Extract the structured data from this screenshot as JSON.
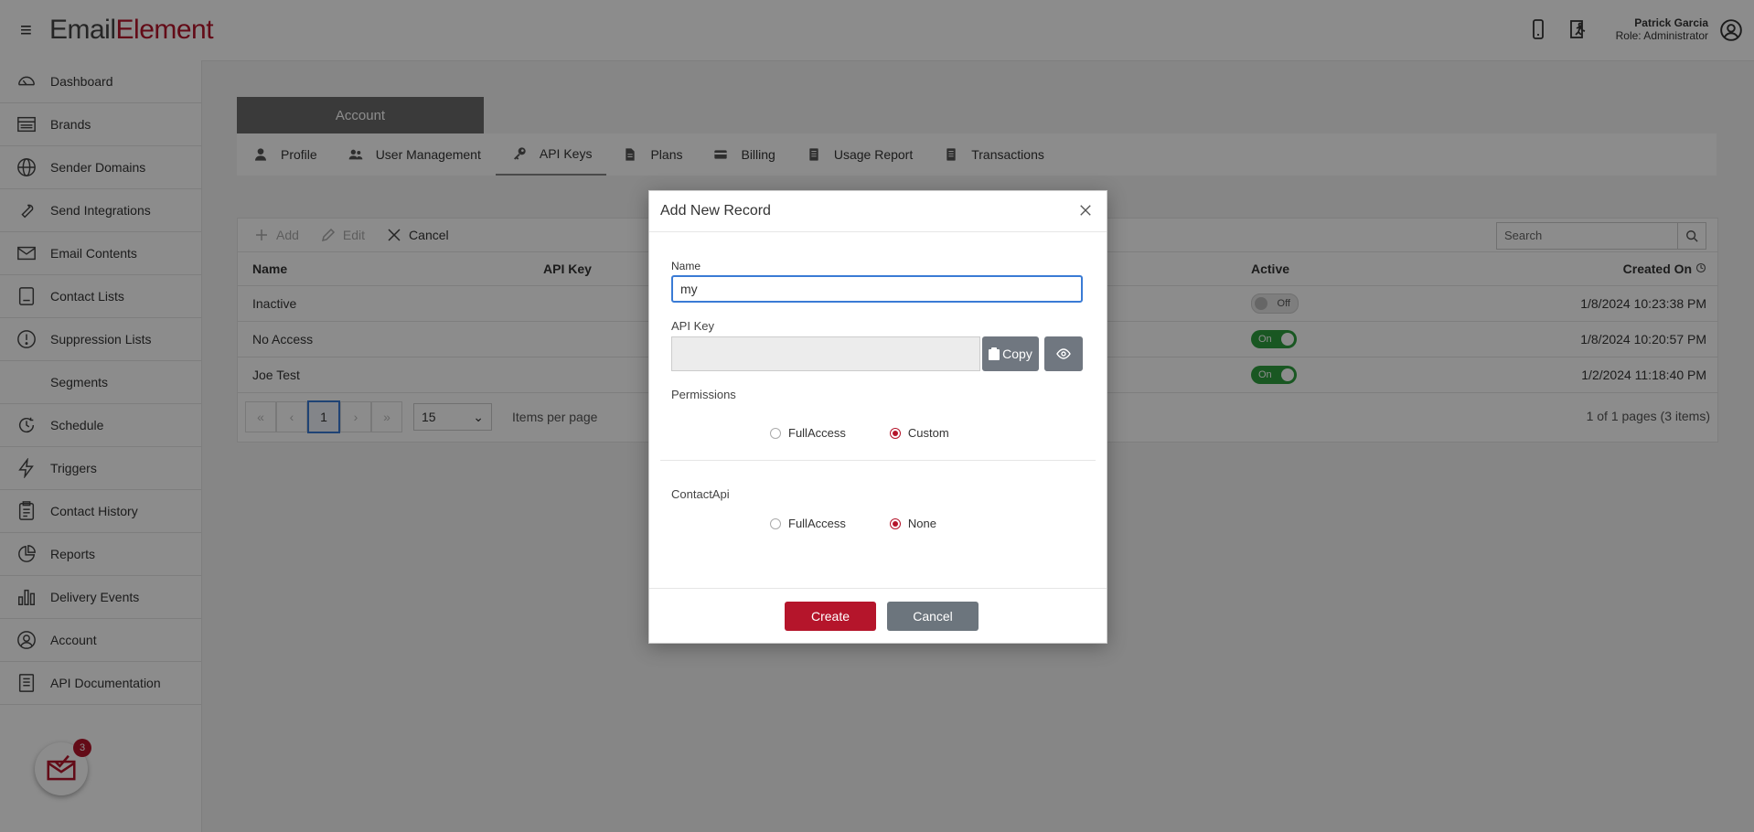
{
  "app": {
    "logo_part1": "Em",
    "logo_part2": "ail",
    "logo_part3": "Element",
    "user_name": "Patrick Garcia",
    "user_role": "Role: Administrator"
  },
  "sidebar": {
    "items": [
      {
        "label": "Dashboard",
        "icon": "gauge-icon"
      },
      {
        "label": "Brands",
        "icon": "brands-icon"
      },
      {
        "label": "Sender Domains",
        "icon": "globe-icon"
      },
      {
        "label": "Send Integrations",
        "icon": "wrench-icon"
      },
      {
        "label": "Email Contents",
        "icon": "envelope-icon"
      },
      {
        "label": "Contact Lists",
        "icon": "list-icon"
      },
      {
        "label": "Suppression Lists",
        "icon": "alert-icon"
      },
      {
        "label": "Segments",
        "icon": ""
      },
      {
        "label": "Schedule",
        "icon": "clock-icon"
      },
      {
        "label": "Triggers",
        "icon": "bolt-icon"
      },
      {
        "label": "Contact History",
        "icon": "clipboard-icon"
      },
      {
        "label": "Reports",
        "icon": "pie-icon"
      },
      {
        "label": "Delivery Events",
        "icon": "bar-chart-icon"
      },
      {
        "label": "Account",
        "icon": "user-circle-icon"
      },
      {
        "label": "API Documentation",
        "icon": "doc-icon"
      }
    ],
    "notification_count": "3"
  },
  "account": {
    "tab_label": "Account",
    "subtabs": [
      "Profile",
      "User Management",
      "API Keys",
      "Plans",
      "Billing",
      "Usage Report",
      "Transactions"
    ]
  },
  "grid": {
    "toolbar": {
      "add": "Add",
      "edit": "Edit",
      "cancel": "Cancel"
    },
    "search_placeholder": "Search",
    "columns": {
      "name": "Name",
      "api_key": "API Key",
      "active": "Active",
      "created_on": "Created On"
    },
    "rows": [
      {
        "name": "Inactive",
        "active": "Off",
        "created": "1/8/2024 10:23:38 PM"
      },
      {
        "name": "No Access",
        "active": "On",
        "created": "1/8/2024 10:20:57 PM"
      },
      {
        "name": "Joe Test",
        "active": "On",
        "created": "1/2/2024 11:18:40 PM"
      }
    ],
    "pager": {
      "current": "1",
      "page_size": "15",
      "items_per_page": "Items per page",
      "info": "1 of 1 pages (3 items)"
    }
  },
  "dialog": {
    "title": "Add New Record",
    "name_label": "Name",
    "name_value": "my",
    "api_key_label": "API Key",
    "copy_label": "Copy",
    "permissions_label": "Permissions",
    "permissions_options": [
      "FullAccess",
      "Custom"
    ],
    "permissions_selected": "Custom",
    "contactapi_label": "ContactApi",
    "contactapi_options": [
      "FullAccess",
      "None"
    ],
    "contactapi_selected": "None",
    "create_label": "Create",
    "cancel_label": "Cancel"
  },
  "colors": {
    "brand": "#b5152b",
    "toggle_on": "#2e9e3e",
    "secondary": "#6c757d"
  }
}
